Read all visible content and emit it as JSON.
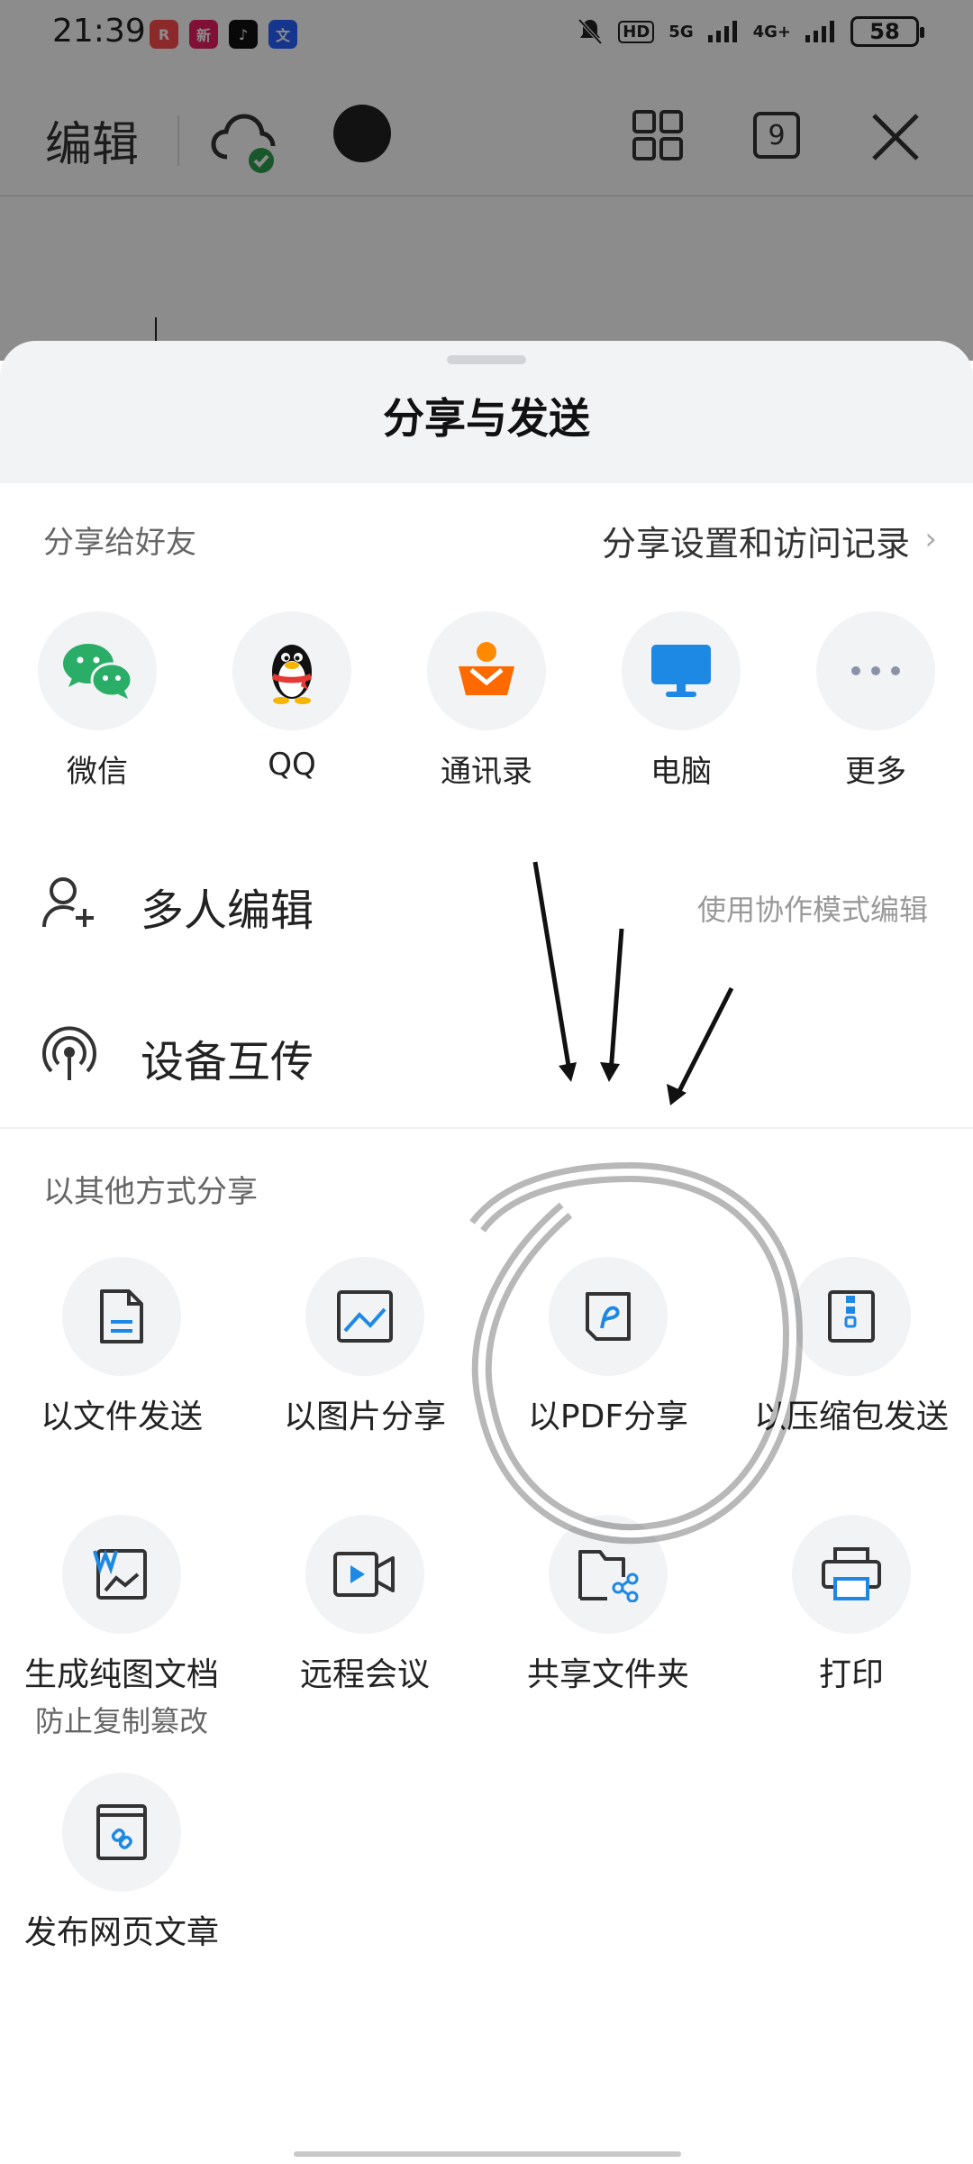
{
  "status_bar": {
    "time": "21:39",
    "apps": [
      {
        "name": "app-icon-1",
        "glyph": "R",
        "color": "#ff4d4f"
      },
      {
        "name": "app-icon-2",
        "glyph": "新",
        "color": "#e91e63"
      },
      {
        "name": "app-icon-3",
        "glyph": "♪",
        "color": "#111111"
      },
      {
        "name": "app-icon-4",
        "glyph": "文",
        "color": "#2962ff"
      }
    ],
    "hd": "HD",
    "net1": "5G",
    "net2": "4G+",
    "battery": "58"
  },
  "top_bar": {
    "title": "编辑",
    "page_count": "9"
  },
  "sheet": {
    "title": "分享与发送",
    "friends_label": "分享给好友",
    "settings_link": "分享设置和访问记录",
    "share_targets": [
      {
        "name": "share-wechat",
        "label": "微信",
        "icon": "wechat-icon",
        "color": "#2aae67"
      },
      {
        "name": "share-qq",
        "label": "QQ",
        "icon": "qq-penguin-icon",
        "color": "#111111"
      },
      {
        "name": "share-contacts",
        "label": "通讯录",
        "icon": "contacts-icon",
        "color": "#ff6a00"
      },
      {
        "name": "share-computer",
        "label": "电脑",
        "icon": "monitor-icon",
        "color": "#1e88e5"
      },
      {
        "name": "share-more",
        "label": "更多",
        "icon": "more-dots-icon",
        "color": "#8a93a6"
      }
    ],
    "multi_edit": {
      "label": "多人编辑",
      "hint": "使用协作模式编辑"
    },
    "device_transfer": {
      "label": "设备互传"
    },
    "other_label": "以其他方式分享",
    "other_options": [
      {
        "name": "send-as-file",
        "label": "以文件发送",
        "icon": "document-icon"
      },
      {
        "name": "share-as-image",
        "label": "以图片分享",
        "icon": "image-icon"
      },
      {
        "name": "share-as-pdf",
        "label": "以PDF分享",
        "icon": "pdf-icon"
      },
      {
        "name": "send-as-zip",
        "label": "以压缩包发送",
        "icon": "zip-icon"
      },
      {
        "name": "generate-image-doc",
        "label": "生成纯图文档",
        "sub": "防止复制篡改",
        "icon": "image-doc-icon"
      },
      {
        "name": "remote-meeting",
        "label": "远程会议",
        "icon": "video-camera-icon"
      },
      {
        "name": "shared-folder",
        "label": "共享文件夹",
        "icon": "shared-folder-icon"
      },
      {
        "name": "print",
        "label": "打印",
        "icon": "printer-icon"
      },
      {
        "name": "publish-web-article",
        "label": "发布网页文章",
        "icon": "web-article-icon"
      }
    ]
  }
}
